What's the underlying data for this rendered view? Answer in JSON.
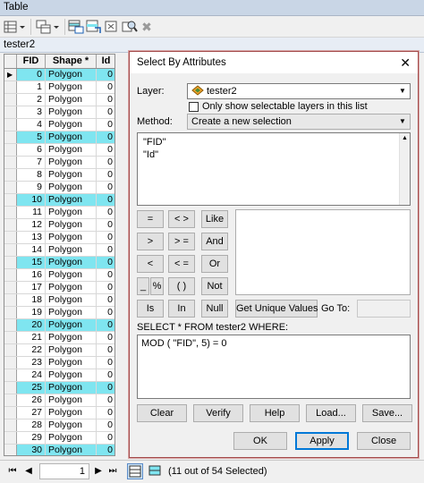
{
  "window": {
    "title": "Table"
  },
  "toolbar": {
    "table_options_icon": "table-options-icon",
    "related_tables_icon": "related-tables-icon",
    "select_by_attributes_icon": "select-by-attributes-icon",
    "switch_selection_icon": "switch-selection-icon",
    "clear_selection_icon": "clear-selection-icon",
    "zoom_to_selected_icon": "zoom-to-selected-icon",
    "delete_selected_icon": "delete-selected-icon"
  },
  "layer_tab": {
    "label": "tester2"
  },
  "table": {
    "columns": [
      "FID",
      "Shape *",
      "Id"
    ],
    "rows": [
      {
        "fid": "0",
        "shape": "Polygon",
        "id": "0",
        "selected": true,
        "current": true
      },
      {
        "fid": "1",
        "shape": "Polygon",
        "id": "0"
      },
      {
        "fid": "2",
        "shape": "Polygon",
        "id": "0"
      },
      {
        "fid": "3",
        "shape": "Polygon",
        "id": "0"
      },
      {
        "fid": "4",
        "shape": "Polygon",
        "id": "0"
      },
      {
        "fid": "5",
        "shape": "Polygon",
        "id": "0",
        "selected": true
      },
      {
        "fid": "6",
        "shape": "Polygon",
        "id": "0"
      },
      {
        "fid": "7",
        "shape": "Polygon",
        "id": "0"
      },
      {
        "fid": "8",
        "shape": "Polygon",
        "id": "0"
      },
      {
        "fid": "9",
        "shape": "Polygon",
        "id": "0"
      },
      {
        "fid": "10",
        "shape": "Polygon",
        "id": "0",
        "selected": true
      },
      {
        "fid": "11",
        "shape": "Polygon",
        "id": "0"
      },
      {
        "fid": "12",
        "shape": "Polygon",
        "id": "0"
      },
      {
        "fid": "13",
        "shape": "Polygon",
        "id": "0"
      },
      {
        "fid": "14",
        "shape": "Polygon",
        "id": "0"
      },
      {
        "fid": "15",
        "shape": "Polygon",
        "id": "0",
        "selected": true
      },
      {
        "fid": "16",
        "shape": "Polygon",
        "id": "0"
      },
      {
        "fid": "17",
        "shape": "Polygon",
        "id": "0"
      },
      {
        "fid": "18",
        "shape": "Polygon",
        "id": "0"
      },
      {
        "fid": "19",
        "shape": "Polygon",
        "id": "0"
      },
      {
        "fid": "20",
        "shape": "Polygon",
        "id": "0",
        "selected": true
      },
      {
        "fid": "21",
        "shape": "Polygon",
        "id": "0"
      },
      {
        "fid": "22",
        "shape": "Polygon",
        "id": "0"
      },
      {
        "fid": "23",
        "shape": "Polygon",
        "id": "0"
      },
      {
        "fid": "24",
        "shape": "Polygon",
        "id": "0"
      },
      {
        "fid": "25",
        "shape": "Polygon",
        "id": "0",
        "selected": true
      },
      {
        "fid": "26",
        "shape": "Polygon",
        "id": "0"
      },
      {
        "fid": "27",
        "shape": "Polygon",
        "id": "0"
      },
      {
        "fid": "28",
        "shape": "Polygon",
        "id": "0"
      },
      {
        "fid": "29",
        "shape": "Polygon",
        "id": "0"
      },
      {
        "fid": "30",
        "shape": "Polygon",
        "id": "0",
        "selected": true
      }
    ]
  },
  "status": {
    "current_record": "1",
    "selection_text": "(11 out of 54 Selected)"
  },
  "dialog": {
    "title": "Select By Attributes",
    "close_glyph": "✕",
    "layer_label": "Layer:",
    "layer_value": "tester2",
    "only_selectable_label": "Only show selectable layers in this list",
    "method_label": "Method:",
    "method_value": "Create a new selection",
    "fields": [
      "\"FID\"",
      "\"Id\""
    ],
    "operators": {
      "eq": "=",
      "ne": "< >",
      "like": "Like",
      "gt": ">",
      "ge": "> =",
      "and": "And",
      "lt": "<",
      "le": "< =",
      "or": "Or",
      "underscore": "_",
      "percent": "%",
      "parens": "( )",
      "not": "Not",
      "is": "Is",
      "in": "In",
      "null": "Null"
    },
    "get_unique_values": "Get Unique Values",
    "goto_label": "Go To:",
    "sql_label": "SELECT * FROM tester2 WHERE:",
    "expression": "MOD ( \"FID\", 5) = 0",
    "buttons": {
      "clear": "Clear",
      "verify": "Verify",
      "help": "Help",
      "load": "Load...",
      "save": "Save...",
      "ok": "OK",
      "apply": "Apply",
      "close": "Close"
    }
  }
}
